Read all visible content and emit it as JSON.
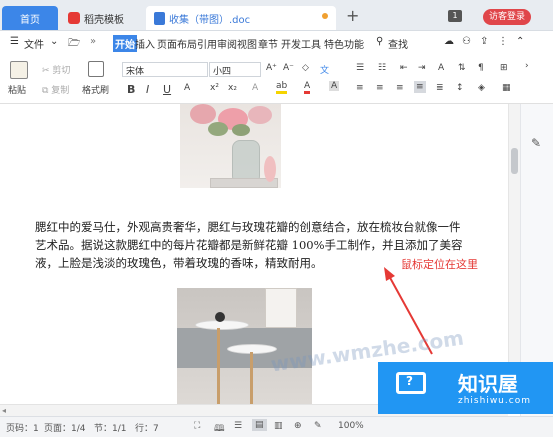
{
  "tabs": {
    "home": "首页",
    "template": "稻壳模板",
    "doc": "收集（带图）.doc",
    "badge": "1",
    "visitor_login": "访客登录"
  },
  "menu": {
    "file": "文件",
    "items": [
      "开始",
      "插入",
      "页面布局",
      "引用",
      "审阅",
      "视图",
      "章节",
      "开发工具",
      "特色功能"
    ],
    "search": "查找"
  },
  "ribbon": {
    "paste": "粘贴",
    "cut": "剪切",
    "copy": "复制",
    "format_painter": "格式刷",
    "font_name": "宋体",
    "font_size": "小四"
  },
  "document": {
    "paragraph": "腮红中的爱马仕，外观高贵奢华，腮红与玫瑰花瓣的创意结合，放在梳妆台就像一件艺术品。据说这款腮红中的每片花瓣都是新鲜花瓣 100%手工制作，并且添加了美容液，上脸是浅淡的玫瑰色，带着玫瑰的香味，精致耐用。",
    "annotation": "鼠标定位在这里",
    "watermark": "www.wmzhe.com"
  },
  "brand": {
    "name": "知识屋",
    "site": "zhishiwu.com"
  },
  "status": {
    "page": "页码：1",
    "pages": "页面：1/4",
    "section": "节：1/1",
    "line": "行：7",
    "zoom": "100%"
  },
  "colors": {
    "accent": "#3c86e8",
    "annotation": "#e53935",
    "brand_bg": "#2196f3"
  }
}
